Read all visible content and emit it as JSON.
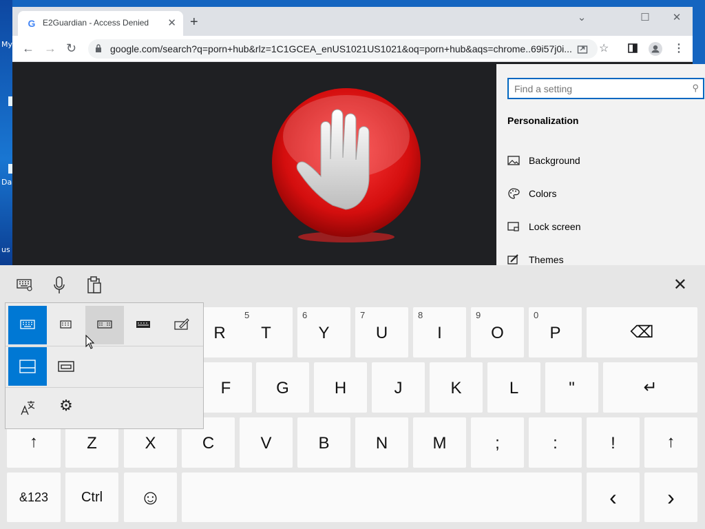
{
  "desktop": {
    "labels": [
      "My",
      "Da",
      "us"
    ]
  },
  "browser": {
    "tab_title": "E2Guardian - Access Denied",
    "tab_close": "✕",
    "new_tab": "+",
    "favicon": "G",
    "window_controls": {
      "minimize": "⌄",
      "maximize": "☐",
      "close": "✕"
    },
    "nav": {
      "back": "←",
      "forward": "→",
      "reload": "↻"
    },
    "url": "google.com/search?q=porn+hub&rlz=1C1GCEA_enUS1021US1021&oq=porn+hub&aqs=chrome..69i57j0i...",
    "toolbar_icons": [
      "share-icon",
      "star-icon",
      "sidepanel-icon",
      "profile-icon",
      "menu-icon"
    ],
    "block_image": "stop-hand-icon"
  },
  "settings": {
    "search_placeholder": "Find a setting",
    "heading": "Personalization",
    "items": [
      {
        "label": "Background",
        "icon": "background-icon"
      },
      {
        "label": "Colors",
        "icon": "palette-icon"
      },
      {
        "label": "Lock screen",
        "icon": "lock-screen-icon"
      },
      {
        "label": "Themes",
        "icon": "themes-icon"
      }
    ]
  },
  "keyboard": {
    "toolbar": [
      "keyboard-settings-icon",
      "microphone-icon",
      "clipboard-icon"
    ],
    "close": "✕",
    "row1": [
      {
        "main": "R",
        "sub": ""
      },
      {
        "main": "T",
        "sub": "5"
      },
      {
        "main": "Y",
        "sub": "6"
      },
      {
        "main": "U",
        "sub": "7"
      },
      {
        "main": "I",
        "sub": "8"
      },
      {
        "main": "O",
        "sub": "9"
      },
      {
        "main": "P",
        "sub": "0"
      }
    ],
    "backspace": "⌫",
    "row2": [
      "F",
      "G",
      "H",
      "J",
      "K",
      "L",
      "\""
    ],
    "enter": "↵",
    "row3": [
      "↑",
      "Z",
      "X",
      "C",
      "V",
      "B",
      "N",
      "M",
      ";",
      ":",
      "!",
      "↑"
    ],
    "row4": {
      "symbols": "&123",
      "ctrl": "Ctrl",
      "emoji": "☺",
      "left": "‹",
      "right": "›"
    }
  },
  "layout_popup": {
    "row1": [
      "default-keyboard-icon",
      "small-keyboard-icon",
      "split-keyboard-icon",
      "full-keyboard-icon",
      "handwriting-icon"
    ],
    "row2": [
      "docked-icon",
      "undocked-icon"
    ],
    "row3": [
      "language-icon",
      "settings-gear-icon"
    ]
  },
  "colors": {
    "accent": "#0078d4",
    "stop_red": "#e11d1d"
  }
}
